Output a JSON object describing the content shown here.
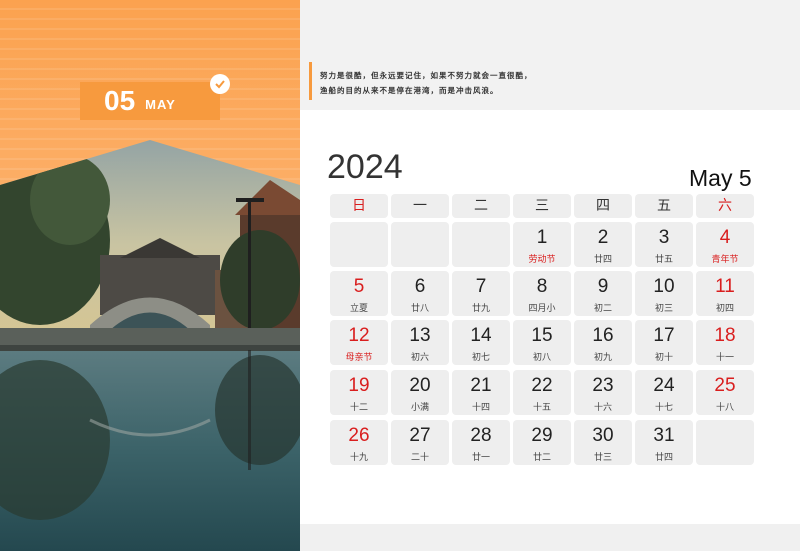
{
  "month": {
    "number": "05",
    "name": "MAY"
  },
  "quote": {
    "line1": "努力是很酷，但永远要记住，如果不努力就会一直很酷，",
    "line2": "渔船的目的从来不是停在港湾，而是冲击风浪。"
  },
  "year": "2024",
  "date_label": "May 5",
  "weekdays": [
    "日",
    "一",
    "二",
    "三",
    "四",
    "五",
    "六"
  ],
  "weeks": [
    [
      {
        "n": "",
        "s": ""
      },
      {
        "n": "",
        "s": ""
      },
      {
        "n": "",
        "s": ""
      },
      {
        "n": "1",
        "s": "劳动节"
      },
      {
        "n": "2",
        "s": "廿四"
      },
      {
        "n": "3",
        "s": "廿五"
      },
      {
        "n": "4",
        "s": "青年节"
      }
    ],
    [
      {
        "n": "5",
        "s": "立夏"
      },
      {
        "n": "6",
        "s": "廿八"
      },
      {
        "n": "7",
        "s": "廿九"
      },
      {
        "n": "8",
        "s": "四月小"
      },
      {
        "n": "9",
        "s": "初二"
      },
      {
        "n": "10",
        "s": "初三"
      },
      {
        "n": "11",
        "s": "初四"
      }
    ],
    [
      {
        "n": "12",
        "s": "母亲节"
      },
      {
        "n": "13",
        "s": "初六"
      },
      {
        "n": "14",
        "s": "初七"
      },
      {
        "n": "15",
        "s": "初八"
      },
      {
        "n": "16",
        "s": "初九"
      },
      {
        "n": "17",
        "s": "初十"
      },
      {
        "n": "18",
        "s": "十一"
      }
    ],
    [
      {
        "n": "19",
        "s": "十二"
      },
      {
        "n": "20",
        "s": "小满"
      },
      {
        "n": "21",
        "s": "十四"
      },
      {
        "n": "22",
        "s": "十五"
      },
      {
        "n": "23",
        "s": "十六"
      },
      {
        "n": "24",
        "s": "十七"
      },
      {
        "n": "25",
        "s": "十八"
      }
    ],
    [
      {
        "n": "26",
        "s": "十九"
      },
      {
        "n": "27",
        "s": "二十"
      },
      {
        "n": "28",
        "s": "廿一"
      },
      {
        "n": "29",
        "s": "廿二"
      },
      {
        "n": "30",
        "s": "廿三"
      },
      {
        "n": "31",
        "s": "廿四"
      },
      {
        "n": "",
        "s": ""
      }
    ]
  ],
  "holiday_labels": [
    "劳动节",
    "青年节",
    "母亲节"
  ],
  "colors": {
    "accent": "#f79a3e",
    "weekend_red": "#d91e1e",
    "cell_bg": "#eeeeee"
  }
}
